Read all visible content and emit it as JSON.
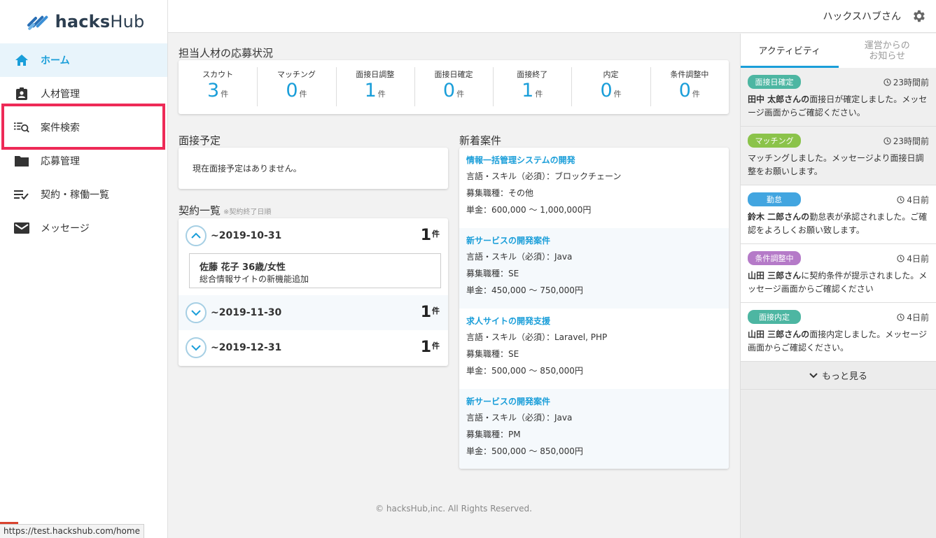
{
  "brand": {
    "name_bold": "hacks",
    "name_rest": "Hub"
  },
  "sidebar": {
    "items": [
      {
        "label": "ホーム"
      },
      {
        "label": "人材管理"
      },
      {
        "label": "案件検索"
      },
      {
        "label": "応募管理"
      },
      {
        "label": "契約・稼働一覧"
      },
      {
        "label": "メッセージ"
      }
    ]
  },
  "header": {
    "user_name": "ハックスハブさん"
  },
  "status": {
    "title": "担当人材の応募状況",
    "unit": "件",
    "items": [
      {
        "label": "スカウト",
        "value": "3"
      },
      {
        "label": "マッチング",
        "value": "0"
      },
      {
        "label": "面接日調整",
        "value": "1"
      },
      {
        "label": "面接日確定",
        "value": "0"
      },
      {
        "label": "面接終了",
        "value": "1"
      },
      {
        "label": "内定",
        "value": "0"
      },
      {
        "label": "条件調整中",
        "value": "0"
      }
    ]
  },
  "interview": {
    "title": "面接予定",
    "empty_text": "現在面接予定はありません。"
  },
  "contracts": {
    "title": "契約一覧",
    "note": "※契約終了日順",
    "unit": "件",
    "rows": [
      {
        "date": "~2019-10-31",
        "count": "1",
        "detail_name": "佐藤 花子 36歳/女性",
        "detail_project": "総合情報サイトの新機能追加"
      },
      {
        "date": "~2019-11-30",
        "count": "1"
      },
      {
        "date": "~2019-12-31",
        "count": "1"
      }
    ]
  },
  "new_cases": {
    "title": "新着案件",
    "items": [
      {
        "title": "情報一括管理システムの開発",
        "skill": "言語・スキル（必須）：ブロックチェーン",
        "role": "募集職種：その他",
        "price": "単金：600,000 ～ 1,000,000円"
      },
      {
        "title": "新サービスの開発案件",
        "skill": "言語・スキル（必須）：Java",
        "role": "募集職種：SE",
        "price": "単金：450,000 ～ 750,000円"
      },
      {
        "title": "求人サイトの開発支援",
        "skill": "言語・スキル（必須）：Laravel, PHP",
        "role": "募集職種：SE",
        "price": "単金：500,000 ～ 850,000円"
      },
      {
        "title": "新サービスの開発案件",
        "skill": "言語・スキル（必須）：Java",
        "role": "募集職種：PM",
        "price": "単金：500,000 ～ 850,000円"
      }
    ]
  },
  "footer": {
    "text": "© hacksHub,inc. All Rights Reserved."
  },
  "right_panel": {
    "tab_activity": "アクティビティ",
    "tab_notice_1": "運営からの",
    "tab_notice_2": "お知らせ",
    "activities": [
      {
        "badge": "面接日確定",
        "color": "#4db6a2",
        "time": "23時間前",
        "name": "田中 太郎さんの",
        "text": "面接日が確定しました。メッセージ画面からご確認ください。"
      },
      {
        "badge": "マッチング",
        "color": "#8bc34a",
        "time": "23時間前",
        "name": "",
        "text": "マッチングしました。メッセージより面接日調整をお願いします。"
      },
      {
        "badge": "勤怠",
        "color": "#42a5e0",
        "time": "4日前",
        "name": "鈴木 二郎さんの",
        "text": "勤怠表が承認されました。ご確認をよろしくお願い致します。"
      },
      {
        "badge": "条件調整中",
        "color": "#b57ac8",
        "time": "4日前",
        "name": "山田 三郎さん",
        "text": "に契約条件が提示されました。メッセージ画面からご確認ください"
      },
      {
        "badge": "面接内定",
        "color": "#4db6a2",
        "time": "4日前",
        "name": "山田 三郎さんの",
        "text": "面接内定しました。メッセージ画面からご確認ください。"
      }
    ],
    "more": "もっと見る"
  },
  "status_bar": {
    "url": "https://test.hackshub.com/home"
  }
}
